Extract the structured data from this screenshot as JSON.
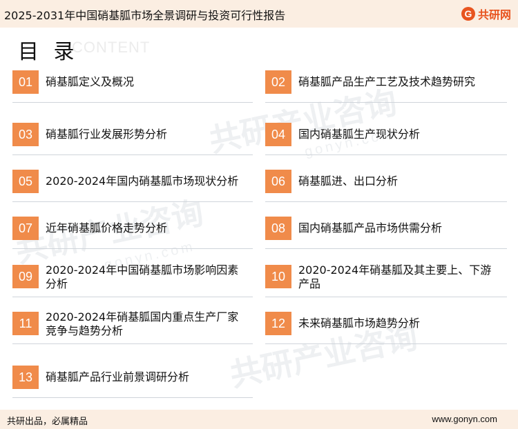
{
  "header": {
    "title": "2025-2031年中国硝基胍市场全景调研与投资可行性报告",
    "logo_mark": "G",
    "logo_text": "共研网"
  },
  "toc": {
    "title": "目 录",
    "subtitle": "CONTENT",
    "items": [
      {
        "num": "01",
        "label": "硝基胍定义及概况"
      },
      {
        "num": "02",
        "label": "硝基胍产品生产工艺及技术趋势研究"
      },
      {
        "num": "03",
        "label": "硝基胍行业发展形势分析"
      },
      {
        "num": "04",
        "label": "国内硝基胍生产现状分析"
      },
      {
        "num": "05",
        "label": "2020-2024年国内硝基胍市场现状分析"
      },
      {
        "num": "06",
        "label": "硝基胍进、出口分析"
      },
      {
        "num": "07",
        "label": "近年硝基胍价格走势分析"
      },
      {
        "num": "08",
        "label": "国内硝基胍产品市场供需分析"
      },
      {
        "num": "09",
        "label": "2020-2024年中国硝基胍市场影响因素分析"
      },
      {
        "num": "10",
        "label": "2020-2024年硝基胍及其主要上、下游产品"
      },
      {
        "num": "11",
        "label": "2020-2024年硝基胍国内重点生产厂家竞争与趋势分析"
      },
      {
        "num": "12",
        "label": "未来硝基胍市场趋势分析"
      },
      {
        "num": "13",
        "label": "硝基胍产品行业前景调研分析"
      }
    ]
  },
  "watermark": {
    "text": "共研产业咨询",
    "url": "gonyn.com"
  },
  "footer": {
    "left": "共研出品，必属精品",
    "right": "www.gonyn.com"
  },
  "colors": {
    "accent": "#f08b4a",
    "band": "#fbeee2",
    "brand": "#e8541f"
  }
}
